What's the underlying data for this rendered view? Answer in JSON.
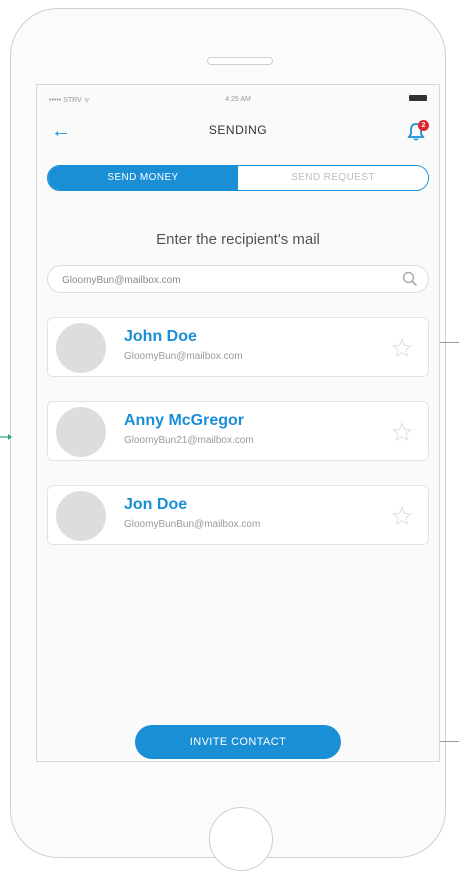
{
  "status_bar": {
    "carrier": "••••• STRV ᯤ",
    "time": "4:25 AM"
  },
  "nav": {
    "title": "SENDING",
    "notification_count": "2"
  },
  "tabs": [
    {
      "label": "SEND MONEY",
      "active": true
    },
    {
      "label": "SEND REQUEST",
      "active": false
    }
  ],
  "prompt": "Enter the recipient's mail",
  "search": {
    "value": "GloomyBun@mailbox.com",
    "placeholder": ""
  },
  "contacts": [
    {
      "name": "John Doe",
      "email": "GloomyBun@mailbox.com"
    },
    {
      "name": "Anny McGregor",
      "email": "GloomyBun21@mailbox.com"
    },
    {
      "name": "Jon Doe",
      "email": "GloomyBunBun@mailbox.com"
    }
  ],
  "invite_button": "INVITE CONTACT",
  "colors": {
    "accent": "#1a8fd6",
    "badge": "#e0262d"
  }
}
